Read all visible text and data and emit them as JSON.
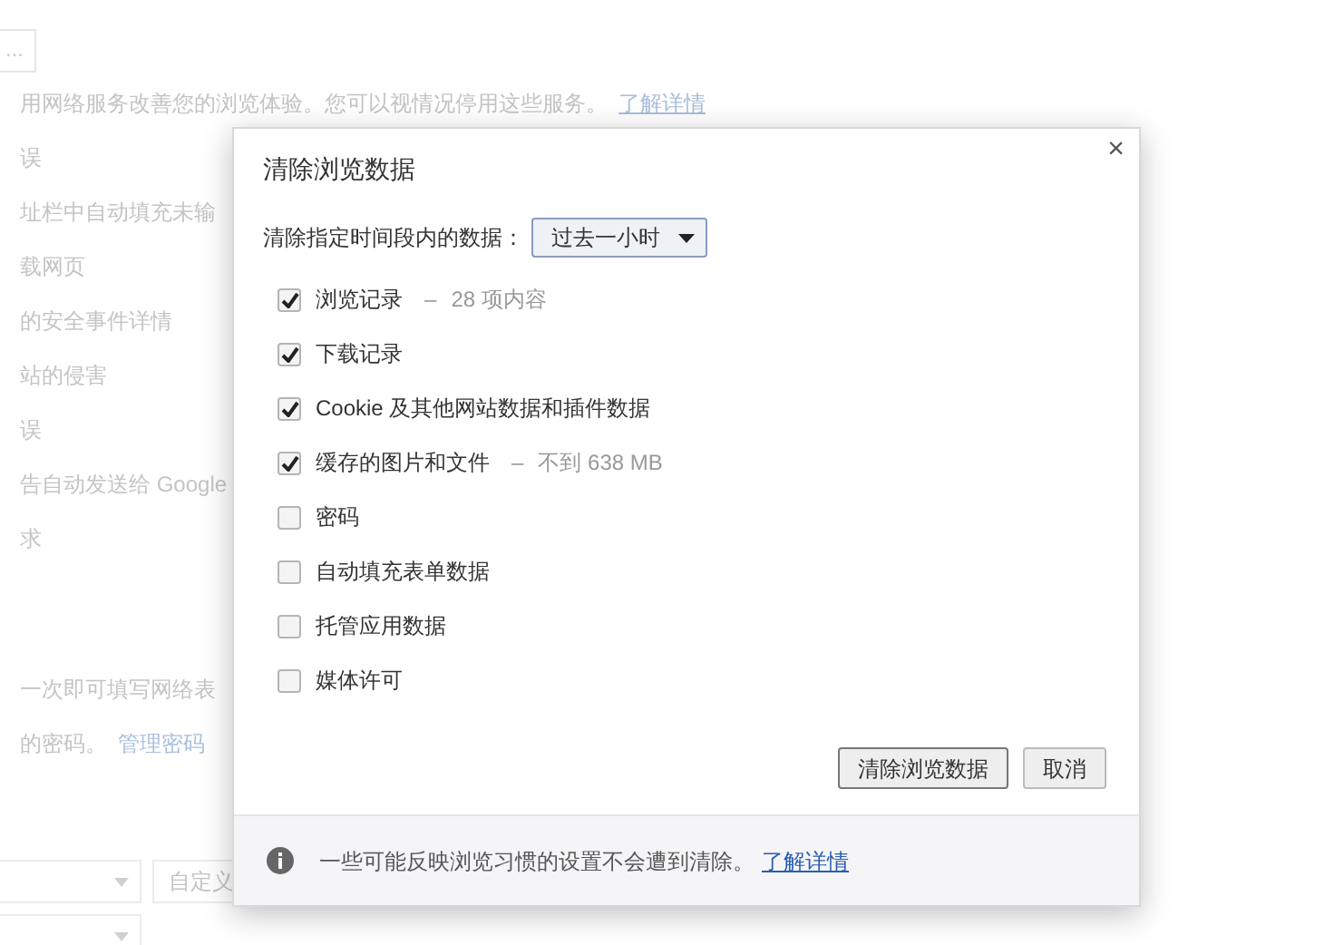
{
  "background_page": {
    "top_button": "...",
    "lines": [
      {
        "text": "用网络服务改善您的浏览体验。您可以视情况停用这些服务。",
        "link": "了解详情"
      },
      {
        "text": "误"
      },
      {
        "text": "址栏中自动填充未输"
      },
      {
        "text": "载网页"
      },
      {
        "text": "的安全事件详情"
      },
      {
        "text": "站的侵害"
      },
      {
        "text": "误"
      },
      {
        "text": "告自动发送给 Google"
      },
      {
        "text": "求"
      },
      {
        "text": "一次即可填写网络表"
      },
      {
        "text": "的密码。",
        "link": "管理密码"
      }
    ],
    "custom_button": "自定义"
  },
  "dialog": {
    "title": "清除浏览数据",
    "close": "×",
    "range_label": "清除指定时间段内的数据：",
    "range_value": "过去一小时",
    "options": [
      {
        "label": "浏览记录",
        "separator": "–",
        "detail": "28 项内容",
        "checked": true
      },
      {
        "label": "下载记录",
        "checked": true
      },
      {
        "label": "Cookie 及其他网站数据和插件数据",
        "checked": true
      },
      {
        "label": "缓存的图片和文件",
        "separator": "–",
        "detail": "不到 638 MB",
        "checked": true
      },
      {
        "label": "密码",
        "checked": false
      },
      {
        "label": "自动填充表单数据",
        "checked": false
      },
      {
        "label": "托管应用数据",
        "checked": false
      },
      {
        "label": "媒体许可",
        "checked": false
      }
    ],
    "buttons": [
      "清除浏览数据",
      "取消"
    ],
    "footer": {
      "text": "一些可能反映浏览习惯的设置不会遭到清除。",
      "link": "了解详情"
    }
  }
}
